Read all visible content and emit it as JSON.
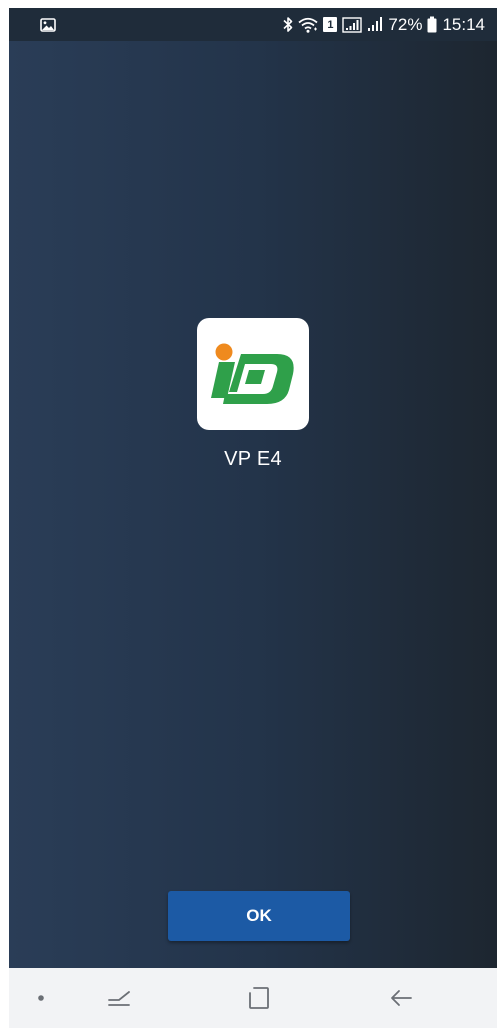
{
  "status_bar": {
    "battery_percent": "72%",
    "time": "15:14",
    "sim_slot": "1",
    "icons": [
      "image-notification-icon",
      "bluetooth-icon",
      "wifi-icon",
      "sim-icon",
      "signal-icon",
      "signal-icon",
      "battery-icon"
    ]
  },
  "app": {
    "name": "VP E4",
    "icon": "app-logo-icon",
    "colors": {
      "logo_green": "#2fa04a",
      "logo_orange": "#ef8a1e"
    }
  },
  "dialog": {
    "ok_label": "OK",
    "ok_color": "#1c5aa5"
  },
  "nav_bar": {
    "items": [
      "dot-icon",
      "recent-apps-icon",
      "home-icon",
      "back-icon"
    ]
  }
}
